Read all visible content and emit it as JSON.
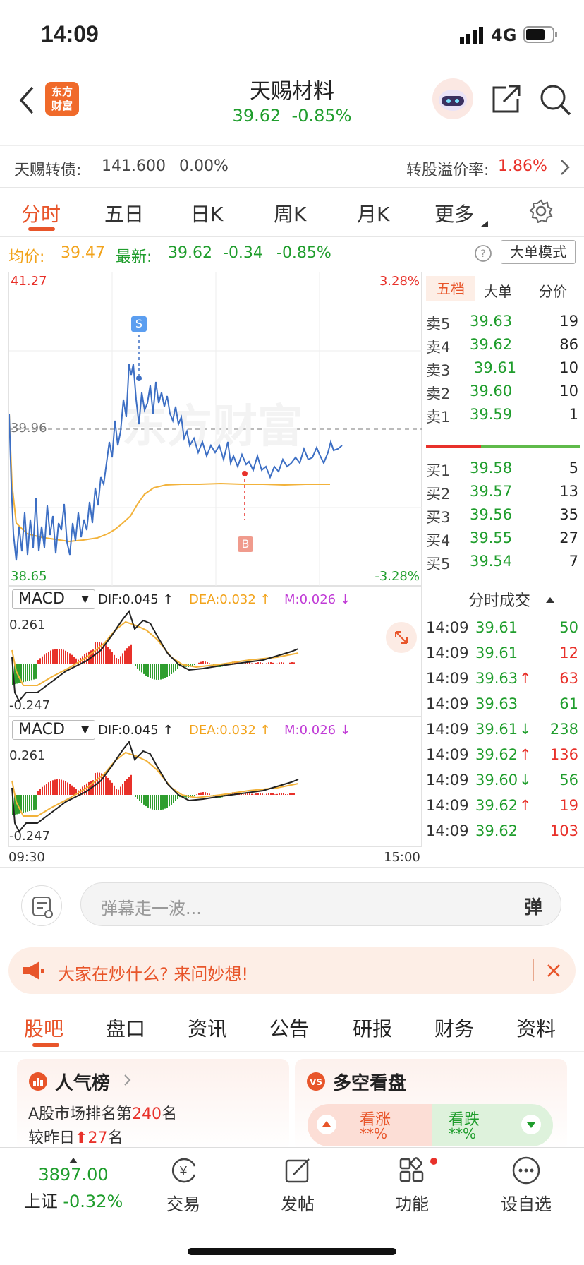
{
  "status": {
    "time": "14:09",
    "network": "4G"
  },
  "header": {
    "title": "天赐材料",
    "price": "39.62",
    "change_pct": "-0.85%",
    "logo_line1": "东方",
    "logo_line2": "财富"
  },
  "bond": {
    "name": "天赐转债:",
    "price": "141.600",
    "pct": "0.00%",
    "premium_label": "转股溢价率:",
    "premium_value": "1.86%"
  },
  "tabs": [
    "分时",
    "五日",
    "日K",
    "周K",
    "月K",
    "更多"
  ],
  "info": {
    "avg_label": "均价:",
    "avg": "39.47",
    "latest_label": "最新:",
    "latest": "39.62",
    "change": "-0.34",
    "pct": "-0.85%",
    "mode_button": "大单模式"
  },
  "chart_labels": {
    "high": "41.27",
    "high_pct": "3.28%",
    "mid": "39.96",
    "low": "38.65",
    "low_pct": "-3.28%",
    "watermark": "东方财富",
    "start_time": "09:30",
    "end_time": "15:00",
    "sell_marker": "S",
    "buy_marker": "B"
  },
  "macd": {
    "name": "MACD",
    "dif": "DIF:0.045 ↑",
    "dea": "DEA:0.032 ↑",
    "m": "M:0.026 ↓",
    "top": "0.261",
    "bottom": "-0.247"
  },
  "orderbook": {
    "tabs": [
      "五档",
      "大单",
      "分价"
    ],
    "asks": [
      {
        "label": "卖5",
        "price": "39.63",
        "vol": "19"
      },
      {
        "label": "卖4",
        "price": "39.62",
        "vol": "86"
      },
      {
        "label": "卖3",
        "price": "39.61",
        "vol": "10"
      },
      {
        "label": "卖2",
        "price": "39.60",
        "vol": "10"
      },
      {
        "label": "卖1",
        "price": "39.59",
        "vol": "1"
      }
    ],
    "bids": [
      {
        "label": "买1",
        "price": "39.58",
        "vol": "5"
      },
      {
        "label": "买2",
        "price": "39.57",
        "vol": "13"
      },
      {
        "label": "买3",
        "price": "39.56",
        "vol": "35"
      },
      {
        "label": "买4",
        "price": "39.55",
        "vol": "27"
      },
      {
        "label": "买5",
        "price": "39.54",
        "vol": "7"
      }
    ]
  },
  "trades": {
    "title": "分时成交",
    "rows": [
      {
        "time": "14:09",
        "price": "39.61",
        "arrow": "",
        "vol": "50",
        "vol_color": "green"
      },
      {
        "time": "14:09",
        "price": "39.61",
        "arrow": "",
        "vol": "12",
        "vol_color": "red"
      },
      {
        "time": "14:09",
        "price": "39.63",
        "arrow": "↑",
        "vol": "63",
        "vol_color": "red"
      },
      {
        "time": "14:09",
        "price": "39.63",
        "arrow": "",
        "vol": "61",
        "vol_color": "green"
      },
      {
        "time": "14:09",
        "price": "39.61",
        "arrow": "↓",
        "vol": "238",
        "vol_color": "green"
      },
      {
        "time": "14:09",
        "price": "39.62",
        "arrow": "↑",
        "vol": "136",
        "vol_color": "red"
      },
      {
        "time": "14:09",
        "price": "39.60",
        "arrow": "↓",
        "vol": "56",
        "vol_color": "green"
      },
      {
        "time": "14:09",
        "price": "39.62",
        "arrow": "↑",
        "vol": "19",
        "vol_color": "red"
      },
      {
        "time": "14:09",
        "price": "39.62",
        "arrow": "",
        "vol": "103",
        "vol_color": "red"
      }
    ]
  },
  "comment": {
    "placeholder": "弹幕走一波...",
    "button": "弹"
  },
  "banner": {
    "text": "大家在炒什么? 来问妙想!"
  },
  "navtabs": [
    "股吧",
    "盘口",
    "资讯",
    "公告",
    "研报",
    "财务",
    "资料"
  ],
  "cards": {
    "popularity": {
      "title": "人气榜",
      "line1_prefix": "A股市场排名第",
      "rank": "240",
      "line1_suffix": "名",
      "line2_prefix": "较昨日",
      "change": "27",
      "line2_suffix": "名"
    },
    "sentiment": {
      "title": "多空看盘",
      "up": "看涨",
      "down": "看跌",
      "up_pct": "**%",
      "down_pct": "**%"
    }
  },
  "bottom": {
    "index_value": "3897.00",
    "index_name": "上证",
    "index_pct": "-0.32%",
    "items": [
      "交易",
      "发帖",
      "功能",
      "设自选"
    ]
  }
}
